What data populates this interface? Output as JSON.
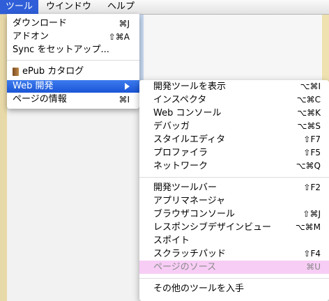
{
  "menubar": {
    "items": [
      "ツール",
      "ウインドウ",
      "ヘルプ"
    ]
  },
  "main_menu": {
    "items": [
      {
        "label": "ダウンロード",
        "shortcut": "⌘J"
      },
      {
        "label": "アドオン",
        "shortcut": "⇧⌘A"
      },
      {
        "label": "Sync をセットアップ...",
        "shortcut": ""
      },
      {
        "label": "ePub カタログ",
        "shortcut": "",
        "icon": "book-icon"
      },
      {
        "label": "Web 開発",
        "shortcut": "",
        "submenu": true,
        "highlighted": true
      },
      {
        "label": "ページの情報",
        "shortcut": "⌘I"
      }
    ]
  },
  "submenu": {
    "items": [
      {
        "label": "開発ツールを表示",
        "shortcut": "⌥⌘I"
      },
      {
        "label": "インスペクタ",
        "shortcut": "⌥⌘C"
      },
      {
        "label": "Web コンソール",
        "shortcut": "⌥⌘K"
      },
      {
        "label": "デバッガ",
        "shortcut": "⌥⌘S"
      },
      {
        "label": "スタイルエディタ",
        "shortcut": "⇧F7"
      },
      {
        "label": "プロファイラ",
        "shortcut": "⇧F5"
      },
      {
        "label": "ネットワーク",
        "shortcut": "⌥⌘Q"
      },
      {
        "label": "開発ツールバー",
        "shortcut": "⇧F2"
      },
      {
        "label": "アプリマネージャ",
        "shortcut": ""
      },
      {
        "label": "ブラウザコンソール",
        "shortcut": "⇧⌘J"
      },
      {
        "label": "レスポンシブデザインビュー",
        "shortcut": "⌥⌘M"
      },
      {
        "label": "スポイト",
        "shortcut": ""
      },
      {
        "label": "スクラッチパッド",
        "shortcut": "⇧F4"
      },
      {
        "label": "ページのソース",
        "shortcut": "⌘U",
        "disabled": true
      },
      {
        "label": "その他のツールを入手",
        "shortcut": ""
      }
    ]
  },
  "colors": {
    "highlight": "#2f5ed8",
    "disabled_bg": "#f7cdf5"
  }
}
